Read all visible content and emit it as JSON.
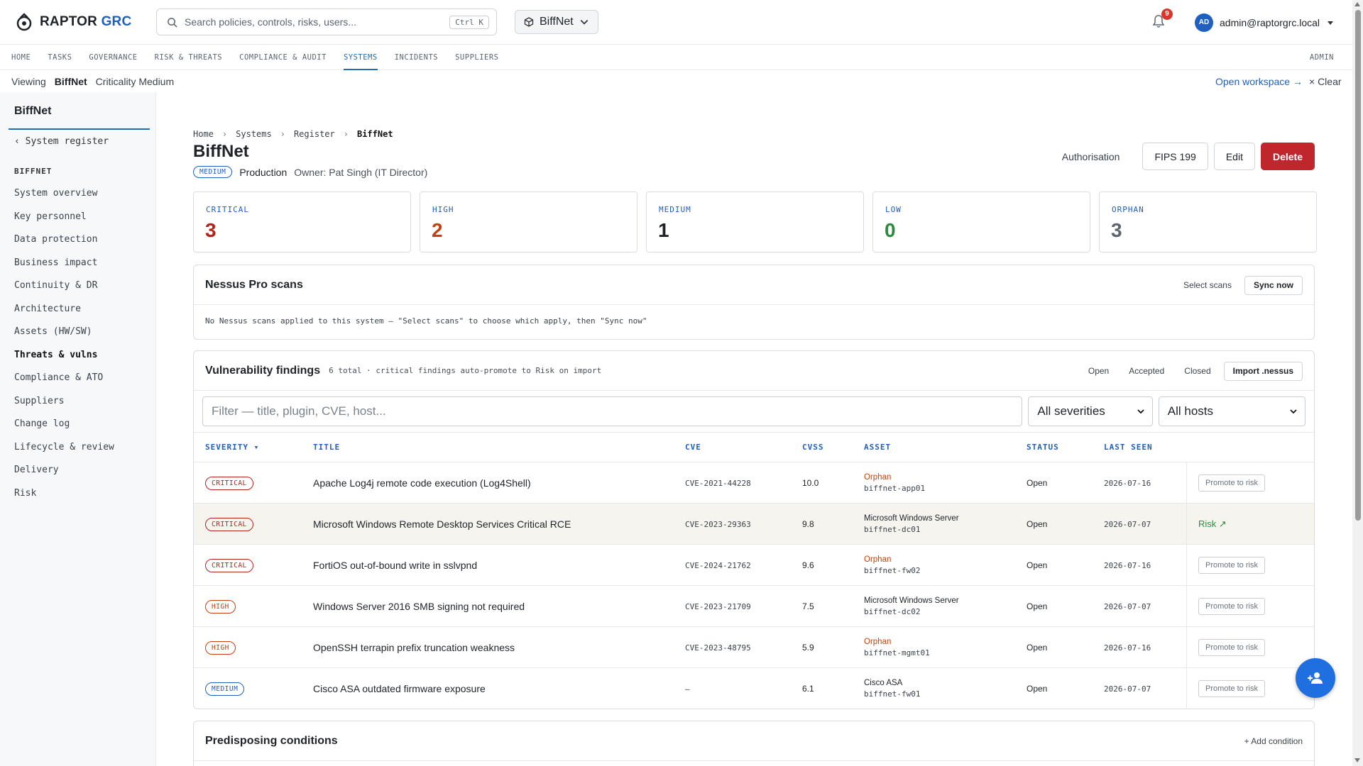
{
  "app": {
    "brand_main": "RAPTOR",
    "brand_accent": "GRC",
    "search_placeholder": "Search policies, controls, risks, users...",
    "search_shortcut": "Ctrl K",
    "system_switch": "BiffNet",
    "notification_count": "9",
    "user_initials": "AD",
    "user_email": "admin@raptorgrc.local"
  },
  "nav": {
    "items": [
      "HOME",
      "TASKS",
      "GOVERNANCE",
      "RISK & THREATS",
      "COMPLIANCE & AUDIT",
      "SYSTEMS",
      "INCIDENTS",
      "SUPPLIERS"
    ],
    "active": "SYSTEMS",
    "admin": "ADMIN"
  },
  "viewbar": {
    "viewing": "Viewing",
    "system": "BiffNet",
    "criticality": "Criticality Medium",
    "open_workspace": "Open workspace →",
    "clear": "× Clear"
  },
  "sidebar": {
    "title": "BiffNet",
    "back": "‹ System register",
    "section": "BIFFNET",
    "items": [
      "System overview",
      "Key personnel",
      "Data protection",
      "Business impact",
      "Continuity & DR",
      "Architecture",
      "Assets (HW/SW)",
      "Threats & vulns",
      "Compliance & ATO",
      "Suppliers",
      "Change log",
      "Lifecycle & review",
      "Delivery",
      "Risk"
    ],
    "active": "Threats & vulns"
  },
  "page": {
    "breadcrumb": [
      "Home",
      "Systems",
      "Register",
      "BiffNet"
    ],
    "breadcrumb_sep": "›",
    "title": "BiffNet",
    "criticality_badge": "MEDIUM",
    "environment": "Production",
    "owner": "Owner: Pat Singh (IT Director)",
    "actions": {
      "authorisation": "Authorisation",
      "fips": "FIPS 199",
      "edit": "Edit",
      "delete": "Delete"
    }
  },
  "stats": [
    {
      "label": "CRITICAL",
      "value": "3",
      "label_color": "#1f5fbf",
      "value_color": "#b42318"
    },
    {
      "label": "HIGH",
      "value": "2",
      "label_color": "#1f5fbf",
      "value_color": "#c2410c"
    },
    {
      "label": "MEDIUM",
      "value": "1",
      "label_color": "#1f5fbf",
      "value_color": "#1f2328"
    },
    {
      "label": "LOW",
      "value": "0",
      "label_color": "#1f5fbf",
      "value_color": "#2e8a3e"
    },
    {
      "label": "ORPHAN",
      "value": "3",
      "label_color": "#1f5fbf",
      "value_color": "#5d6570"
    }
  ],
  "nessus": {
    "title": "Nessus Pro scans",
    "select": "Select scans",
    "sync": "Sync now",
    "empty": "No Nessus scans applied to this system — \"Select scans\" to choose which apply, then \"Sync now\""
  },
  "vulns": {
    "title": "Vulnerability findings",
    "meta": "6 total · critical findings auto-promote to Risk on import",
    "tab_open": "Open",
    "tab_accepted": "Accepted",
    "tab_closed": "Closed",
    "import": "Import .nessus",
    "filter_placeholder": "Filter — title, plugin, CVE, host...",
    "severity_select": "All severities",
    "hosts_select": "All hosts",
    "columns": {
      "severity": "SEVERITY ▾",
      "title": "TITLE",
      "cve": "CVE",
      "cvss": "CVSS",
      "asset": "ASSET",
      "status": "STATUS",
      "last_seen": "LAST SEEN"
    },
    "promote_label": "Promote to risk",
    "risk_label": "Risk ↗",
    "rows": [
      {
        "severity": "CRITICAL",
        "title": "Apache Log4j remote code execution (Log4Shell)",
        "cve": "CVE-2021-44228",
        "cvss": "10.0",
        "asset": "Orphan",
        "orphan": true,
        "host": "biffnet-app01",
        "status": "Open",
        "last_seen": "2026-07-16",
        "promoted": false
      },
      {
        "severity": "CRITICAL",
        "title": "Microsoft Windows Remote Desktop Services Critical RCE",
        "cve": "CVE-2023-29363",
        "cvss": "9.8",
        "asset": "Microsoft Windows Server",
        "orphan": false,
        "host": "biffnet-dc01",
        "status": "Open",
        "last_seen": "2026-07-07",
        "promoted": true
      },
      {
        "severity": "CRITICAL",
        "title": "FortiOS out-of-bound write in sslvpnd",
        "cve": "CVE-2024-21762",
        "cvss": "9.6",
        "asset": "Orphan",
        "orphan": true,
        "host": "biffnet-fw02",
        "status": "Open",
        "last_seen": "2026-07-16",
        "promoted": false
      },
      {
        "severity": "HIGH",
        "title": "Windows Server 2016 SMB signing not required",
        "cve": "CVE-2023-21709",
        "cvss": "7.5",
        "asset": "Microsoft Windows Server",
        "orphan": false,
        "host": "biffnet-dc02",
        "status": "Open",
        "last_seen": "2026-07-07",
        "promoted": false
      },
      {
        "severity": "HIGH",
        "title": "OpenSSH terrapin prefix truncation weakness",
        "cve": "CVE-2023-48795",
        "cvss": "5.9",
        "asset": "Orphan",
        "orphan": true,
        "host": "biffnet-mgmt01",
        "status": "Open",
        "last_seen": "2026-07-16",
        "promoted": false
      },
      {
        "severity": "MEDIUM",
        "title": "Cisco ASA outdated firmware exposure",
        "cve": "—",
        "cvss": "6.1",
        "asset": "Cisco ASA",
        "orphan": false,
        "host": "biffnet-fw01",
        "status": "Open",
        "last_seen": "2026-07-07",
        "promoted": false
      }
    ],
    "severity_colors": {
      "CRITICAL": "#b42318",
      "HIGH": "#c2410c",
      "MEDIUM": "#1f5fbf"
    },
    "orphan_color": "#c2410c"
  },
  "predisposing": {
    "title": "Predisposing conditions",
    "add": "+ Add condition"
  }
}
